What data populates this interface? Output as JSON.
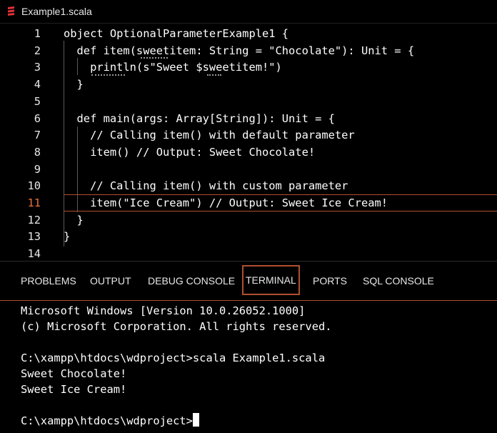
{
  "tab": {
    "filename": "Example1.scala",
    "icon": "scala-file-icon",
    "icon_color": "#e0323a"
  },
  "editor": {
    "active_line": 11,
    "lines": [
      {
        "n": "1",
        "text": "object OptionalParameterExample1 {"
      },
      {
        "n": "2",
        "text": "  def item(sweetitem: String = \"Chocolate\"): Unit = {"
      },
      {
        "n": "3",
        "text": "    println(s\"Sweet $sweetitem!\")"
      },
      {
        "n": "4",
        "text": "  }"
      },
      {
        "n": "5",
        "text": ""
      },
      {
        "n": "6",
        "text": "  def main(args: Array[String]): Unit = {"
      },
      {
        "n": "7",
        "text": "    // Calling item() with default parameter"
      },
      {
        "n": "8",
        "text": "    item() // Output: Sweet Chocolate!"
      },
      {
        "n": "9",
        "text": ""
      },
      {
        "n": "10",
        "text": "    // Calling item() with custom parameter"
      },
      {
        "n": "11",
        "text": "    item(\"Ice Cream\") // Output: Sweet Ice Cream!"
      },
      {
        "n": "12",
        "text": "  }"
      },
      {
        "n": "13",
        "text": "}"
      },
      {
        "n": "14",
        "text": ""
      }
    ]
  },
  "panel": {
    "tabs": [
      "PROBLEMS",
      "OUTPUT",
      "DEBUG CONSOLE",
      "TERMINAL",
      "PORTS",
      "SQL CONSOLE"
    ],
    "active_tab": "TERMINAL"
  },
  "terminal": {
    "lines": [
      "Microsoft Windows [Version 10.0.26052.1000]",
      "(c) Microsoft Corporation. All rights reserved.",
      "",
      "C:\\xampp\\htdocs\\wdproject>scala Example1.scala",
      "Sweet Chocolate!",
      "Sweet Ice Cream!",
      "",
      "C:\\xampp\\htdocs\\wdproject>"
    ]
  },
  "colors": {
    "accent": "#b05030",
    "active_line_number": "#e8703a",
    "background": "#000000"
  }
}
